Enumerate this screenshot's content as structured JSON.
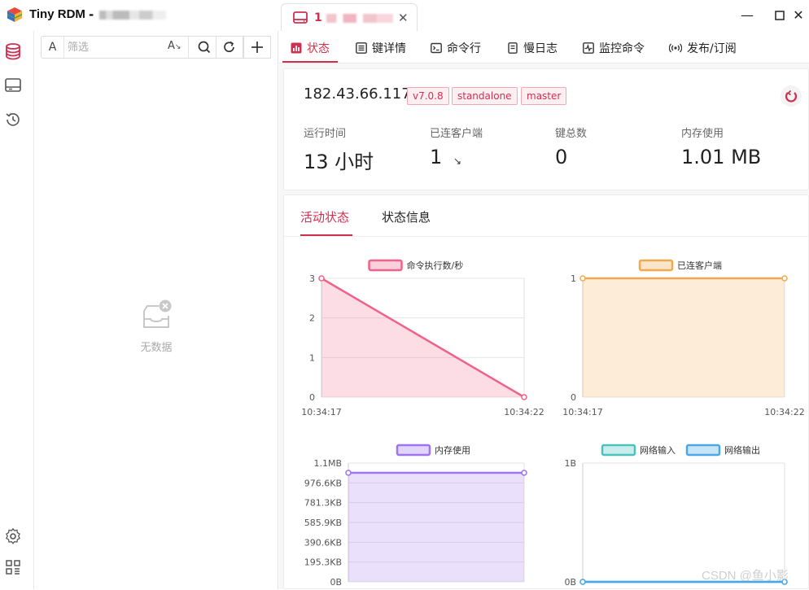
{
  "app": {
    "title": "Tiny RDM",
    "title_sep": "-",
    "tab_label": "1",
    "window_controls": [
      "minimize-icon",
      "maximize-icon",
      "close-icon"
    ]
  },
  "rail": {
    "icons": [
      "database-icon",
      "terminal-icon",
      "history-icon",
      "settings-icon",
      "apps-icon"
    ]
  },
  "sidebar": {
    "filter_prefix": "A",
    "filter_placeholder": "筛选",
    "filter_case": "A",
    "empty_text": "无数据"
  },
  "subtabs": [
    {
      "label": "状态",
      "icon": "status-icon",
      "active": true
    },
    {
      "label": "键详情",
      "icon": "key-detail-icon",
      "active": false
    },
    {
      "label": "命令行",
      "icon": "terminal-icon",
      "active": false
    },
    {
      "label": "慢日志",
      "icon": "slow-log-icon",
      "active": false
    },
    {
      "label": "监控命令",
      "icon": "monitor-icon",
      "active": false
    },
    {
      "label": "发布/订阅",
      "icon": "broadcast-icon",
      "active": false
    }
  ],
  "server": {
    "host": "182.43.66.117",
    "badges": [
      "v7.0.8",
      "standalone",
      "master"
    ]
  },
  "stats": [
    {
      "label": "运行时间",
      "value": "13 小时"
    },
    {
      "label": "已连客户端",
      "value": "1"
    },
    {
      "label": "键总数",
      "value": "0"
    },
    {
      "label": "内存使用",
      "value": "1.01 MB"
    }
  ],
  "client_trend": "↘",
  "content_tabs": [
    {
      "label": "活动状态",
      "active": true
    },
    {
      "label": "状态信息",
      "active": false
    }
  ],
  "colors": {
    "accent": "#d03050",
    "cmd": "#f0628a",
    "clients": "#f2a94e",
    "memory": "#a073f0",
    "net_in": "#4cc2bd",
    "net_out": "#4aa8e6"
  },
  "chart_data": [
    {
      "type": "area",
      "x": [
        "10:34:17",
        "10:34:22"
      ],
      "series": [
        {
          "name": "命令执行数/秒",
          "values": [
            3,
            0
          ]
        }
      ],
      "yticks": [
        "0",
        "1",
        "2",
        "3"
      ],
      "ylim": [
        0,
        3
      ],
      "legend": "top",
      "grid": true
    },
    {
      "type": "area",
      "x": [
        "10:34:17",
        "10:34:22"
      ],
      "series": [
        {
          "name": "已连客户端",
          "values": [
            1,
            1
          ]
        }
      ],
      "yticks": [
        "0",
        "1"
      ],
      "ylim": [
        0,
        1
      ],
      "legend": "top",
      "grid": true
    },
    {
      "type": "area",
      "x": [],
      "series": [
        {
          "name": "内存使用",
          "values": [
            1.01,
            1.01
          ]
        }
      ],
      "yticks": [
        "0B",
        "195.3KB",
        "390.6KB",
        "585.9KB",
        "781.3KB",
        "976.6KB",
        "1.1MB"
      ],
      "ylim": [
        0,
        1.1
      ],
      "legend": "top",
      "grid": true
    },
    {
      "type": "line",
      "x": [],
      "series": [
        {
          "name": "网络输入",
          "values": [
            0,
            0
          ]
        },
        {
          "name": "网络输出",
          "values": [
            0,
            0
          ]
        }
      ],
      "yticks": [
        "0B",
        "1B"
      ],
      "ylim": [
        0,
        1
      ],
      "legend": "top",
      "grid": true
    }
  ],
  "watermark": "CSDN @鱼小影"
}
